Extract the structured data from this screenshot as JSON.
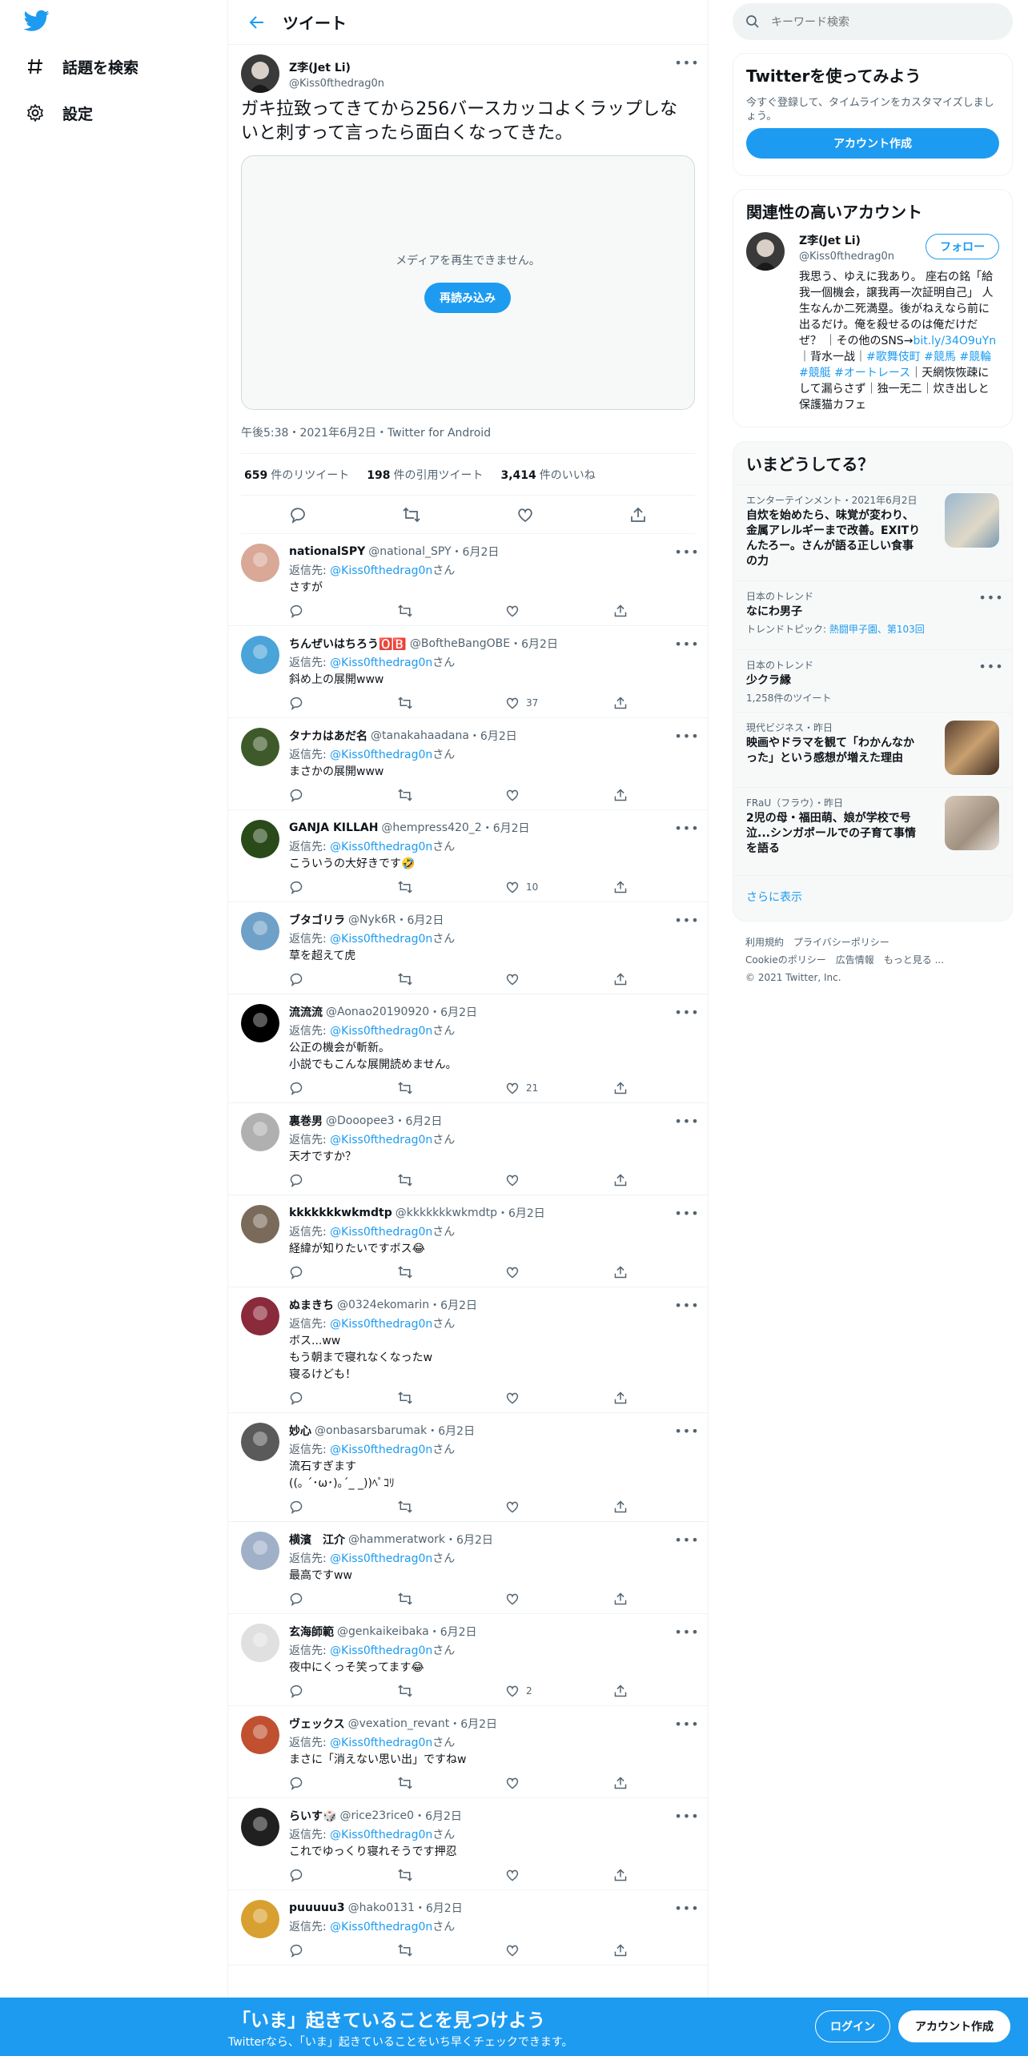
{
  "nav": {
    "explore": "話題を検索",
    "settings": "設定"
  },
  "header": {
    "title": "ツイート"
  },
  "tweet": {
    "name": "Z李(Jet Li)",
    "handle": "@Kiss0fthedrag0n",
    "text": "ガキ拉致ってきてから256バースカッコよくラップしないと刺すって言ったら面白くなってきた。",
    "media_error": "メディアを再生できません。",
    "reload": "再読み込み",
    "meta": "午後5:38・2021年6月2日・Twitter for Android",
    "retweets": "659",
    "retweets_label": "件のリツイート",
    "quotes": "198",
    "quotes_label": "件の引用ツイート",
    "likes": "3,414",
    "likes_label": "件のいいね"
  },
  "reply_prefix": "返信先: ",
  "reply_to": "@Kiss0fthedrag0n",
  "reply_suffix": "さん",
  "replies": [
    {
      "name": "nationalSPY",
      "handle": "@national_SPY",
      "date": "・6月2日",
      "text": "さすが",
      "likes": "",
      "color": "#d9a896"
    },
    {
      "name": "ちんぜいはちろう🅾️🅱️",
      "handle": "@BoftheBangOBE",
      "date": "・6月2日",
      "text": "斜め上の展開www",
      "likes": "37",
      "color": "#4aa3d9"
    },
    {
      "name": "タナカはあだ名",
      "handle": "@tanakahaadana",
      "date": "・6月2日",
      "text": "まさかの展開www",
      "likes": "",
      "color": "#3f5a2a"
    },
    {
      "name": "GANJA KILLAH",
      "handle": "@hempress420_2",
      "date": "・6月2日",
      "text": "こういうの大好きです🤣",
      "likes": "10",
      "color": "#2a4a1a"
    },
    {
      "name": "ブタゴリラ",
      "handle": "@Nyk6R",
      "date": "・6月2日",
      "text": "草を超えて虎",
      "likes": "",
      "color": "#6fa0c8"
    },
    {
      "name": "流流流",
      "handle": "@Aonao20190920",
      "date": "・6月2日",
      "text": "公正の機会が斬新。\n小説でもこんな展開読めません。",
      "likes": "21",
      "color": "#000000"
    },
    {
      "name": "裏巻男",
      "handle": "@Dooopee3",
      "date": "・6月2日",
      "text": "天才ですか？",
      "likes": "",
      "color": "#b0b0b0"
    },
    {
      "name": "kkkkkkkwkmdtp",
      "handle": "@kkkkkkkwkmdtp",
      "date": "・6月2日",
      "text": "経緯が知りたいですボス😂",
      "likes": "",
      "color": "#7a6a5a"
    },
    {
      "name": "ぬまきち",
      "handle": "@0324ekomarin",
      "date": "・6月2日",
      "text": "ボス...ww\nもう朝まで寝れなくなったw\n寝るけども！",
      "likes": "",
      "color": "#8a2a3a"
    },
    {
      "name": "妙心",
      "handle": "@onbasarsbarumak",
      "date": "・6月2日",
      "text": "流石すぎます\n((｡ ´･ω･)｡´_ _))ﾍﾟｺﾘ",
      "likes": "",
      "color": "#5a5a5a"
    },
    {
      "name": "横濱　江介",
      "handle": "@hammeratwork",
      "date": "・6月2日",
      "text": "最高ですww",
      "likes": "",
      "color": "#a0b0c8"
    },
    {
      "name": "玄海師範",
      "handle": "@genkaikeibaka",
      "date": "・6月2日",
      "text": "夜中にくっそ笑ってます😂",
      "likes": "2",
      "color": "#e0e0e0"
    },
    {
      "name": "ヴェックス",
      "handle": "@vexation_revant",
      "date": "・6月2日",
      "text": "まさに「消えない思い出」ですねw",
      "likes": "",
      "color": "#c05030"
    },
    {
      "name": "らいす🎲",
      "handle": "@rice23rice0",
      "date": "・6月2日",
      "text": "これでゆっくり寝れそうです押忍",
      "likes": "",
      "color": "#202020"
    },
    {
      "name": "puuuuu3",
      "handle": "@hako0131",
      "date": "・6月2日",
      "text": "",
      "likes": "",
      "color": "#d8a030"
    }
  ],
  "search": {
    "placeholder": "キーワード検索"
  },
  "signup_card": {
    "title": "Twitterを使ってみよう",
    "desc": "今すぐ登録して、タイムラインをカスタマイズしましょう。",
    "button": "アカウント作成"
  },
  "related": {
    "title": "関連性の高いアカウント",
    "name": "Z李(Jet Li)",
    "handle": "@Kiss0fthedrag0n",
    "follow": "フォロー",
    "bio_a": "我思う、ゆえに我あり。 座右の銘「給我一個機会，譲我再一次証明自己」 人生なんか二死満塁。後がねえなら前に出るだけ。俺を殺せるのは俺だけだぜ？ ｜その他のSNS→",
    "bio_link": "bit.ly/34O9uYn",
    "bio_b": "｜背水一战｜",
    "bio_tags": "#歌舞伎町 #競馬 #競輪 #競艇 #オートレース",
    "bio_c": "｜天網恢恢疎にして漏らさず｜独一无二｜炊き出しと保護猫カフェ"
  },
  "trends": {
    "title": "いまどうしてる？",
    "items": [
      {
        "cat": "エンターテインメント・2021年6月2日",
        "title": "自炊を始めたら、味覚が変わり、金属アレルギーまで改善。EXITりんたろー。さんが語る正しい食事の力",
        "sub": ""
      },
      {
        "cat": "日本のトレンド",
        "title": "なにわ男子",
        "sub_prefix": "トレンドトピック: ",
        "sub": "熱闘甲子園、第103回"
      },
      {
        "cat": "日本のトレンド",
        "title": "少クラ縁",
        "sub": "1,258件のツイート"
      },
      {
        "cat": "現代ビジネス・昨日",
        "title": "映画やドラマを観て「わかんなかった」という感想が増えた理由",
        "sub": ""
      },
      {
        "cat": "FRaU（フラウ）・昨日",
        "title": "2児の母・福田萌、娘が学校で号泣...シンガポールでの子育て事情を語る",
        "sub": ""
      }
    ],
    "show_more": "さらに表示"
  },
  "footer": {
    "l1": [
      "利用規約",
      "プライバシーポリシー"
    ],
    "l2": [
      "Cookieのポリシー",
      "広告情報",
      "もっと見る ..."
    ],
    "l3": "© 2021 Twitter, Inc."
  },
  "bottom": {
    "title": "「いま」起きていることを見つけよう",
    "sub": "Twitterなら、「いま」起きていることをいち早くチェックできます。",
    "login": "ログイン",
    "signup": "アカウント作成"
  }
}
